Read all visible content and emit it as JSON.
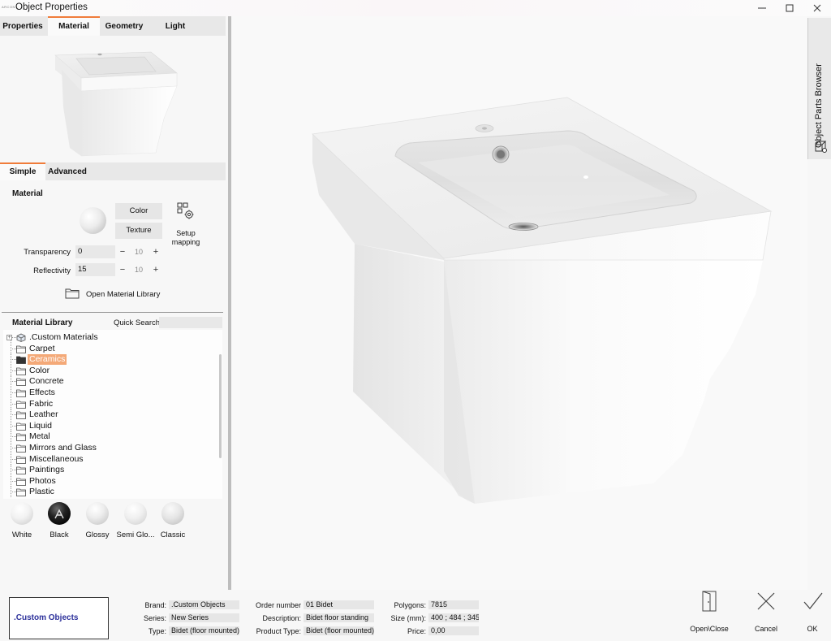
{
  "window": {
    "app_icon_text": "ARCON",
    "title": "Object Properties"
  },
  "top_tabs": [
    {
      "label": "Properties",
      "active": false
    },
    {
      "label": "Material",
      "active": true
    },
    {
      "label": "Geometry",
      "active": false
    },
    {
      "label": "Light",
      "active": false
    }
  ],
  "sub_tabs": [
    {
      "label": "Simple",
      "active": true
    },
    {
      "label": "Advanced",
      "active": false
    }
  ],
  "material": {
    "heading": "Material",
    "color_button": "Color",
    "texture_button": "Texture",
    "setup_mapping": "Setup mapping",
    "transparency_label": "Transparency",
    "transparency_value": "0",
    "transparency_step": "10",
    "reflectivity_label": "Reflectivity",
    "reflectivity_value": "15",
    "reflectivity_step": "10",
    "step_minus": "−",
    "step_plus": "+",
    "open_library": "Open Material Library"
  },
  "library": {
    "heading": "Material Library",
    "quick_search_label": "Quick Search:",
    "quick_search_value": "",
    "items": [
      {
        "label": ".Custom Materials",
        "selected": false,
        "root": true
      },
      {
        "label": "Carpet",
        "selected": false
      },
      {
        "label": "Ceramics",
        "selected": true
      },
      {
        "label": "Color",
        "selected": false
      },
      {
        "label": "Concrete",
        "selected": false
      },
      {
        "label": "Effects",
        "selected": false
      },
      {
        "label": "Fabric",
        "selected": false
      },
      {
        "label": "Leather",
        "selected": false
      },
      {
        "label": "Liquid",
        "selected": false
      },
      {
        "label": "Metal",
        "selected": false
      },
      {
        "label": "Mirrors and Glass",
        "selected": false
      },
      {
        "label": "Miscellaneous",
        "selected": false
      },
      {
        "label": "Paintings",
        "selected": false
      },
      {
        "label": "Photos",
        "selected": false
      },
      {
        "label": "Plastic",
        "selected": false
      }
    ],
    "swatches": [
      {
        "label": "White"
      },
      {
        "label": "Black"
      },
      {
        "label": "Glossy"
      },
      {
        "label": "Semi Glo..."
      },
      {
        "label": "Classic"
      }
    ]
  },
  "side_panel": {
    "label": "Object Parts Browser"
  },
  "footer": {
    "brand_box": ".Custom Objects",
    "brand_label": "Brand:",
    "brand_value": ".Custom Objects",
    "series_label": "Series:",
    "series_value": "New Series",
    "type_label": "Type:",
    "type_value": "Bidet (floor mounted)",
    "order_label": "Order number",
    "order_value": "01 Bidet",
    "description_label": "Description:",
    "description_value": "Bidet floor standing",
    "product_type_label": "Product Type:",
    "product_type_value": "Bidet (floor mounted)",
    "polygons_label": "Polygons:",
    "polygons_value": "7815",
    "size_label": "Size (mm):",
    "size_value": "400 ; 484 ; 345",
    "price_label": "Price:",
    "price_value": "0,00",
    "open_close_label": "Open\\Close",
    "cancel_label": "Cancel",
    "ok_label": "OK"
  },
  "colors": {
    "accent": "#f07c3a",
    "selection": "#f4a978",
    "brand_text": "#2b2f9a"
  }
}
